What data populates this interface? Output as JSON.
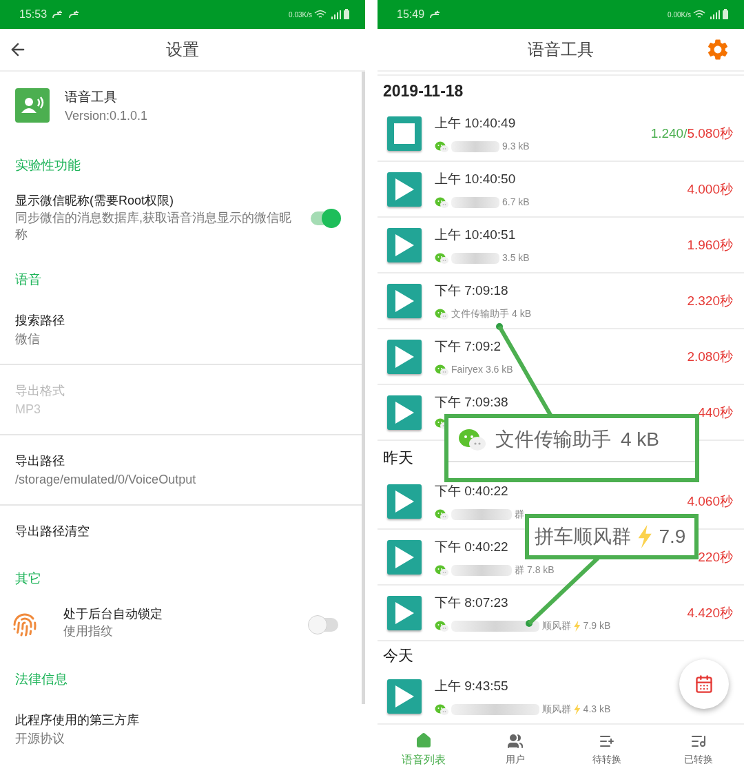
{
  "left": {
    "status_bar": {
      "time": "15:53",
      "notifications": [
        {
          "kind": "link"
        },
        {
          "kind": "link"
        }
      ],
      "speed": "0.03K/s"
    },
    "title": "设置",
    "items": [
      {
        "kind": "app_info",
        "title": "语音工具",
        "subtitle": "Version:0.1.0.1"
      },
      {
        "kind": "header",
        "title": "实验性功能"
      },
      {
        "kind": "switch",
        "title": "显示微信昵称(需要Root权限)",
        "subtitle": "同步微信的消息数据库,获取语音消息显示的微信昵称",
        "on": true
      },
      {
        "kind": "header",
        "title": "语音"
      },
      {
        "kind": "item",
        "title": "搜索路径",
        "subtitle": "微信",
        "disabled": false
      },
      {
        "kind": "item",
        "title": "导出格式",
        "subtitle": "MP3",
        "disabled": true
      },
      {
        "kind": "item",
        "title": "导出路径",
        "subtitle": "/storage/emulated/0/VoiceOutput",
        "disabled": false
      },
      {
        "kind": "item",
        "title": "导出路径清空",
        "disabled": false
      },
      {
        "kind": "header",
        "title": "其它"
      },
      {
        "kind": "fingerprint_switch",
        "title": "处于后台自动锁定",
        "subtitle": "使用指纹",
        "on": false
      },
      {
        "kind": "header",
        "title": "法律信息"
      },
      {
        "kind": "item",
        "title": "此程序使用的第三方库",
        "subtitle": "开源协议",
        "disabled": false
      }
    ]
  },
  "right": {
    "status_bar": {
      "time": "15:49",
      "notifications": [
        {
          "kind": "link"
        }
      ],
      "speed": "0.00K/s"
    },
    "title": "语音工具",
    "groups": [
      {
        "date": "2019-11-18",
        "rows": [
          {
            "time": "上午 10:40:49",
            "playing": true,
            "blurred": true,
            "lightning": false,
            "size": "9.3 kB",
            "progress": "1.240/",
            "duration": "5.080秒"
          },
          {
            "time": "上午 10:40:50",
            "playing": false,
            "blurred": true,
            "lightning": false,
            "size": "6.7 kB",
            "duration": "4.000秒"
          },
          {
            "time": "上午 10:40:51",
            "playing": false,
            "blurred": true,
            "lightning": false,
            "size": "3.5 kB",
            "duration": "1.960秒"
          },
          {
            "time": "下午 7:09:18",
            "playing": false,
            "blurred": false,
            "lightning": false,
            "sender": "文件传输助手",
            "size": "4 kB",
            "duration": "2.320秒"
          },
          {
            "time": "下午 7:09:2",
            "playing": false,
            "blurred": false,
            "lightning": false,
            "sender": "Fairyex",
            "size": "3.6 kB",
            "duration": "2.080秒"
          },
          {
            "time": "下午 7:09:38",
            "playing": false,
            "blurred": false,
            "lightning": false,
            "duration": "440秒"
          }
        ]
      },
      {
        "date": "昨天",
        "rows": [
          {
            "time": "下午 0:40:22",
            "playing": false,
            "blurred": true,
            "lightning": false,
            "sender": "群",
            "duration": "4.060秒"
          },
          {
            "time": "下午 0:40:22",
            "playing": false,
            "blurred": true,
            "lightning": false,
            "sender": "群",
            "size": "7.8 kB",
            "duration": "220秒"
          },
          {
            "time": "下午 8:07:23",
            "playing": false,
            "blurred": true,
            "lightning": true,
            "sender": "顺风群",
            "size": "7.9 kB",
            "duration": "4.420秒"
          }
        ]
      },
      {
        "date": "今天",
        "rows": [
          {
            "time": "上午 9:43:55",
            "playing": false,
            "blurred": true,
            "lightning": true,
            "sender": "顺风群",
            "size": "4.3 kB"
          }
        ]
      }
    ],
    "callouts": [
      {
        "name": "文件传输助手",
        "size": "4 kB",
        "wechat_icon": true,
        "lightning": false
      },
      {
        "name": "拼车顺风群",
        "size": "7.9",
        "wechat_icon": false,
        "lightning": true
      }
    ],
    "nav": [
      {
        "label": "语音列表",
        "kind": "home",
        "selected": true
      },
      {
        "label": "用户",
        "kind": "users",
        "selected": false
      },
      {
        "label": "待转换",
        "kind": "list_add",
        "selected": false
      },
      {
        "label": "已转换",
        "kind": "list_music",
        "selected": false
      }
    ]
  }
}
